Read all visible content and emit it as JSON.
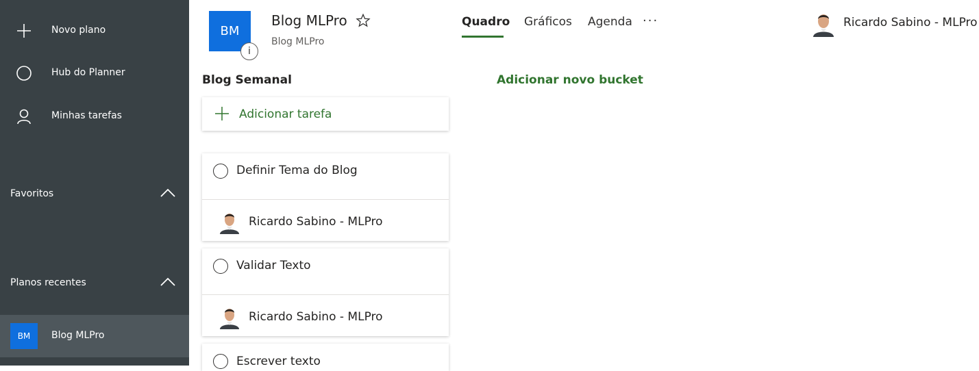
{
  "sidebar": {
    "nav": [
      {
        "label": "Novo plano",
        "icon": "plus-icon"
      },
      {
        "label": "Hub do Planner",
        "icon": "circle-icon"
      },
      {
        "label": "Minhas tarefas",
        "icon": "person-icon"
      }
    ],
    "favorites_label": "Favoritos",
    "recent_label": "Planos recentes",
    "recent_items": [
      {
        "initials": "BM",
        "label": "Blog MLPro"
      }
    ]
  },
  "header": {
    "plan_initials": "BM",
    "info_label": "i",
    "plan_title": "Blog MLPro",
    "plan_subtitle": "Blog MLPro",
    "tabs": [
      {
        "label": "Quadro",
        "active": true
      },
      {
        "label": "Gráficos",
        "active": false
      },
      {
        "label": "Agenda",
        "active": false
      }
    ],
    "more_label": "···",
    "user_name": "Ricardo Sabino - MLPro"
  },
  "board": {
    "bucket_title": "Blog Semanal",
    "add_task_label": "Adicionar tarefa",
    "add_bucket_label": "Adicionar novo bucket",
    "tasks": [
      {
        "title": "Definir Tema do Blog",
        "assignee": "Ricardo Sabino - MLPro"
      },
      {
        "title": "Validar Texto",
        "assignee": "Ricardo Sabino - MLPro"
      },
      {
        "title": "Escrever texto"
      }
    ]
  },
  "colors": {
    "sidebar_bg": "#394145",
    "sidebar_selected": "#4e575c",
    "plan_avatar": "#0f6fde",
    "accent_green": "#31752f"
  }
}
